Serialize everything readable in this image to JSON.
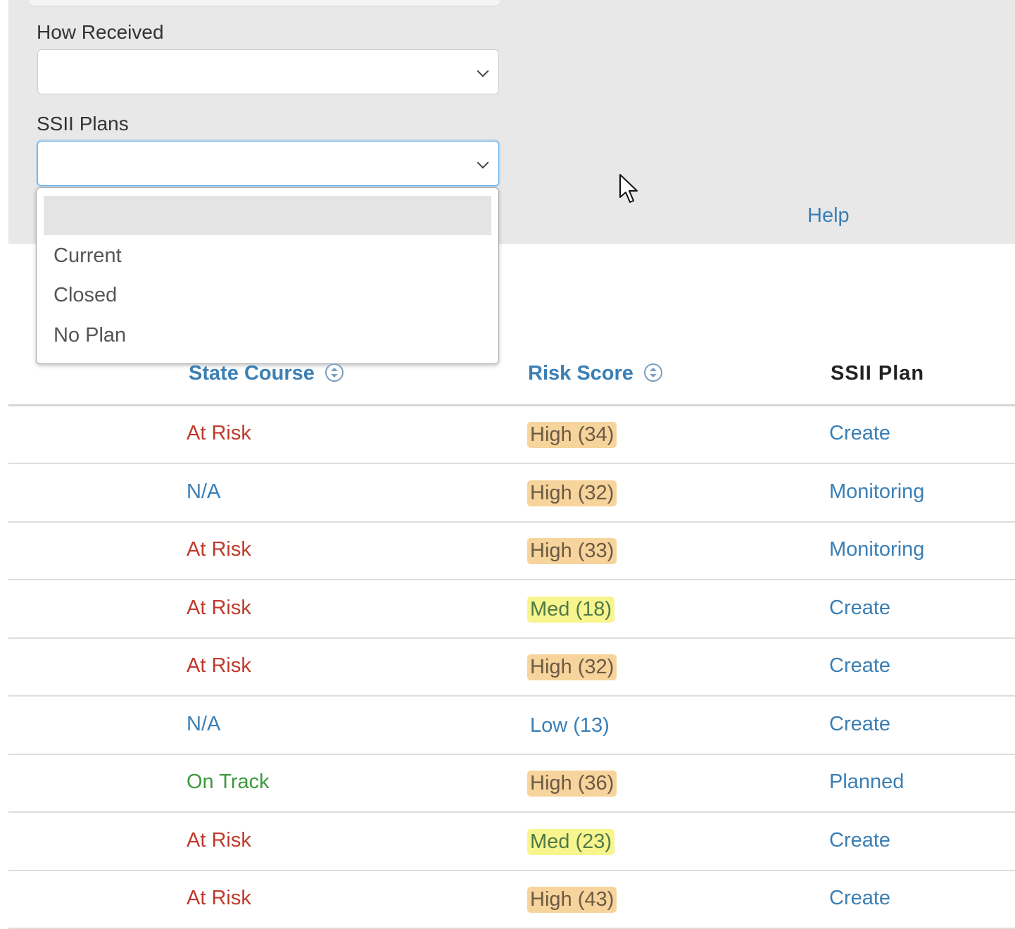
{
  "filters": {
    "how_received": {
      "label": "How Received",
      "value": ""
    },
    "ssii_plans": {
      "label": "SSII Plans",
      "value": "",
      "options": [
        "",
        "Current",
        "Closed",
        "No Plan"
      ]
    },
    "help_label": "Help"
  },
  "table": {
    "headers": {
      "state_course": "State Course",
      "risk_score": "Risk Score",
      "ssii_plan": "SSII Plan"
    },
    "rows": [
      {
        "state": "At Risk",
        "state_status": "at-risk",
        "risk": "High (34)",
        "risk_level": "high",
        "plan": "Create"
      },
      {
        "state": "N/A",
        "state_status": "na",
        "risk": "High (32)",
        "risk_level": "high",
        "plan": "Monitoring"
      },
      {
        "state": "At Risk",
        "state_status": "at-risk",
        "risk": "High (33)",
        "risk_level": "high",
        "plan": "Monitoring"
      },
      {
        "state": "At Risk",
        "state_status": "at-risk",
        "risk": "Med (18)",
        "risk_level": "med",
        "plan": "Create"
      },
      {
        "state": "At Risk",
        "state_status": "at-risk",
        "risk": "High (32)",
        "risk_level": "high",
        "plan": "Create"
      },
      {
        "state": "N/A",
        "state_status": "na",
        "risk": "Low (13)",
        "risk_level": "low",
        "plan": "Create"
      },
      {
        "state": "On Track",
        "state_status": "on-track",
        "risk": "High (36)",
        "risk_level": "high",
        "plan": "Planned"
      },
      {
        "state": "At Risk",
        "state_status": "at-risk",
        "risk": "Med (23)",
        "risk_level": "med",
        "plan": "Create"
      },
      {
        "state": "At Risk",
        "state_status": "at-risk",
        "risk": "High (43)",
        "risk_level": "high",
        "plan": "Create"
      }
    ]
  },
  "colors": {
    "at-risk": "#c0392b",
    "na": "#3a7fb5",
    "on-track": "#3c9a3c",
    "link": "#3a7fb5",
    "risk_high_bg": "#f7d49c",
    "risk_high_fg": "#6b5a45",
    "risk_med_bg": "#f8f58f",
    "risk_med_fg": "#4f7a47",
    "risk_low_fg": "#3a7fb5"
  },
  "icons": {
    "cursor": "mouse-pointer-icon",
    "sort": "sort-icon",
    "chevron": "chevron-down-icon"
  }
}
